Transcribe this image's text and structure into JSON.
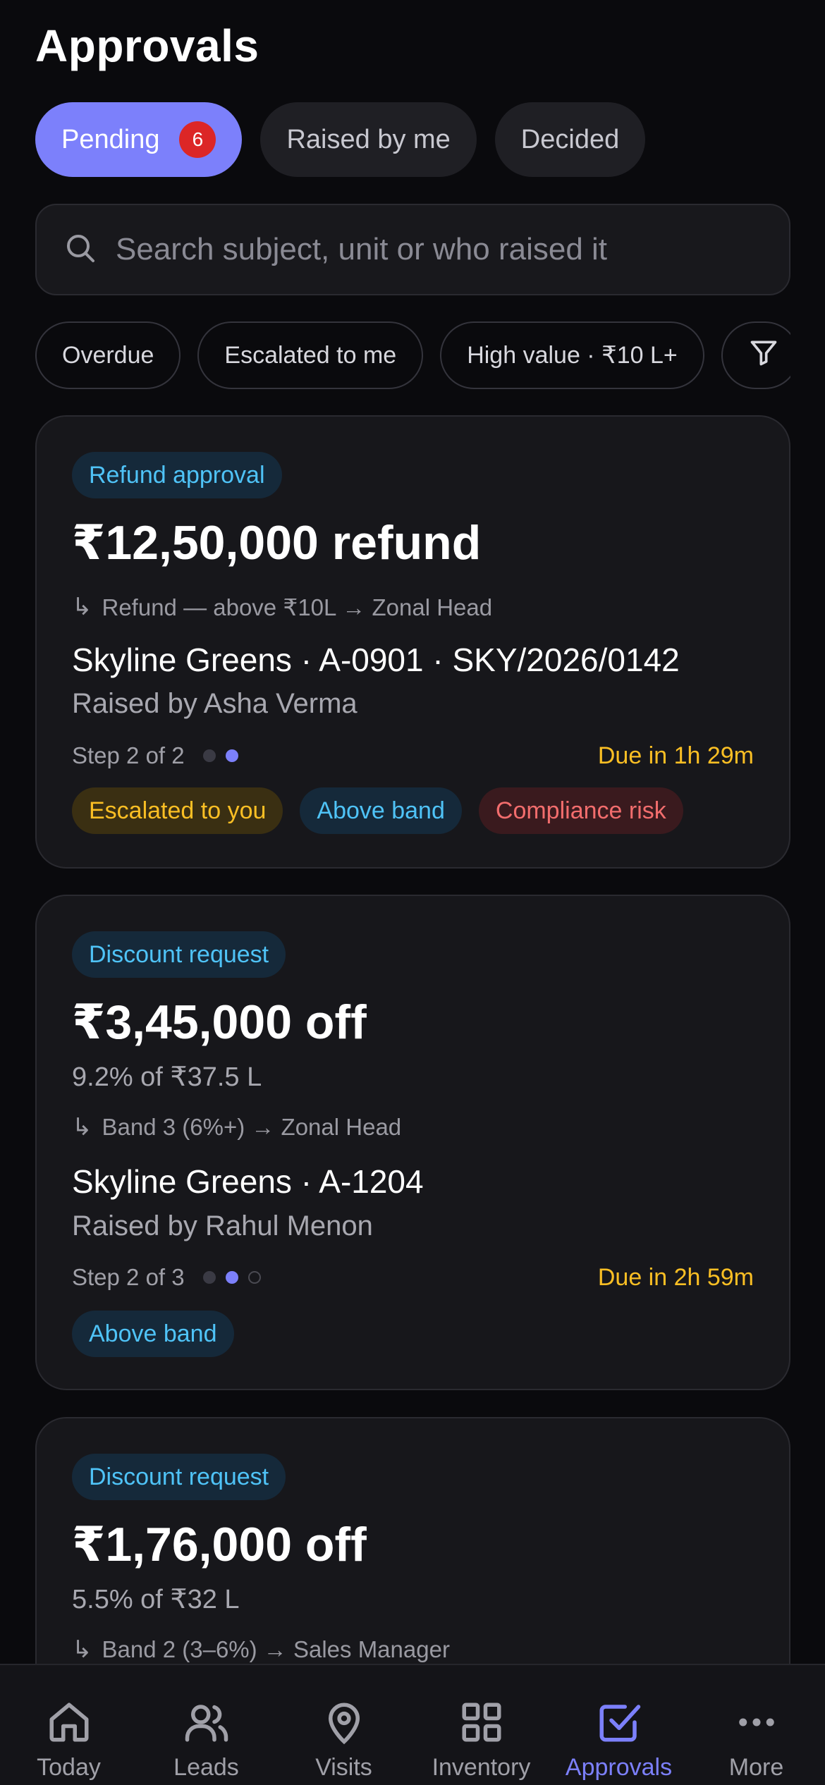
{
  "header": {
    "title": "Approvals"
  },
  "tabs": [
    {
      "label": "Pending",
      "badge": "6",
      "active": true
    },
    {
      "label": "Raised by me",
      "active": false
    },
    {
      "label": "Decided",
      "active": false
    }
  ],
  "search": {
    "placeholder": "Search subject, unit or who raised it",
    "icon": "search-icon"
  },
  "filters": [
    {
      "label": "Overdue"
    },
    {
      "label": "Escalated to me"
    },
    {
      "label": "High value · ₹10 L+"
    },
    {
      "icon": "filter-icon"
    }
  ],
  "cards": [
    {
      "type": "Refund approval",
      "amount": "₹12,50,000 refund",
      "route": "Refund — above ₹10L → Zonal Head",
      "project": "Skyline Greens · A-0901 · SKY/2026/0142",
      "raised_by": "Raised by Asha Verma",
      "step": "Step 2 of 2",
      "due": "Due in 1h 29m",
      "tags": [
        "Escalated to you",
        "Above band",
        "Compliance risk"
      ]
    },
    {
      "type": "Discount request",
      "amount": "₹3,45,000 off",
      "subline": "9.2% of ₹37.5 L",
      "route": "Band 3 (6%+) → Zonal Head",
      "project": "Skyline Greens · A-1204",
      "raised_by": "Raised by Rahul Menon",
      "step": "Step 2 of 3",
      "due": "Due in 2h 59m",
      "tags": [
        "Above band"
      ]
    },
    {
      "type": "Discount request",
      "amount": "₹1,76,000 off",
      "subline": "5.5% of ₹32 L",
      "route": "Band 2 (3–6%) → Sales Manager"
    }
  ],
  "nav": [
    {
      "label": "Today",
      "icon": "home-icon"
    },
    {
      "label": "Leads",
      "icon": "users-icon"
    },
    {
      "label": "Visits",
      "icon": "map-pin-icon"
    },
    {
      "label": "Inventory",
      "icon": "grid-icon"
    },
    {
      "label": "Approvals",
      "icon": "check-square-icon",
      "active": true
    },
    {
      "label": "More",
      "icon": "more-icon"
    }
  ],
  "colors": {
    "accent": "#7c80fb",
    "badge": "#dc2626",
    "due": "#fbbf24",
    "info": "#4fc3f7",
    "risk": "#f26d6d"
  }
}
